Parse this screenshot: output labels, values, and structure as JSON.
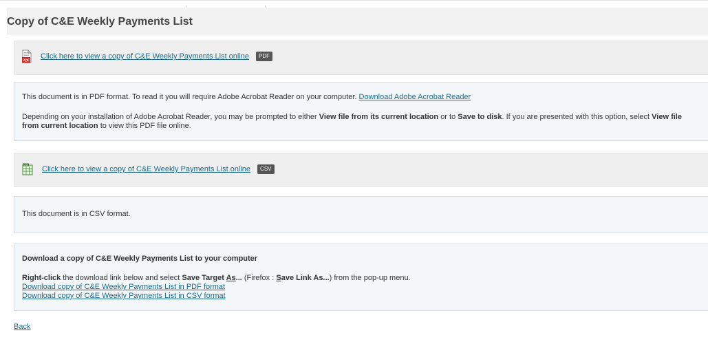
{
  "page": {
    "title": "Copy of C&E Weekly Payments List"
  },
  "pdf_link": {
    "icon": "pdf-file-icon",
    "text": "Click here to view a copy of C&E Weekly Payments List online",
    "badge": "PDF"
  },
  "pdf_info": {
    "line1_text": "This document is in PDF format. To read it you will require Adobe Acrobat Reader on your computer.",
    "line1_link": "Download Adobe Acrobat Reader",
    "line2_a": "Depending on your installation of Adobe Acrobat Reader, you may be prompted to either",
    "line2_b": "View file from its current location",
    "line2_c": "or to",
    "line2_d": "Save to disk",
    "line2_e": ". If you are presented with this option, select",
    "line2_f": "View file from current location",
    "line2_g": "to view this PDF file online."
  },
  "csv_link": {
    "icon": "spreadsheet-file-icon",
    "text": "Click here to view a copy of C&E Weekly Payments List online",
    "badge": "CSV"
  },
  "csv_info": {
    "text": "This document is in CSV format."
  },
  "download": {
    "heading": "Download a copy of C&E Weekly Payments List to your computer",
    "rc_bold": "Right-click",
    "rc_text1": "the download link below and select",
    "save_target_1": "Save Target",
    "save_target_2": "As",
    "save_target_3": "...",
    "rc_text2": "(Firefox :",
    "save_link_1": "S",
    "save_link_2": "ave Link As...",
    "rc_text3": ") from the pop-up menu.",
    "pdf_link": "Download copy of C&E Weekly Payments List in PDF format",
    "csv_link": "Download copy of C&E Weekly Payments List in CSV format"
  },
  "back_link": "Back"
}
